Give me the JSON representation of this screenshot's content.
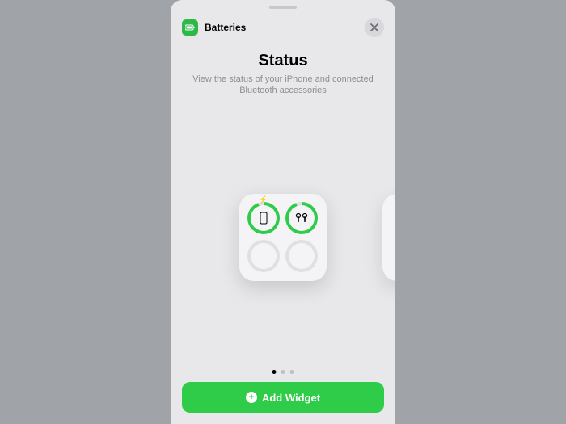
{
  "header": {
    "app_name": "Batteries"
  },
  "content": {
    "title": "Status",
    "subtitle": "View the status of your iPhone and connected Bluetooth accessories"
  },
  "widget": {
    "slots": [
      {
        "device": "iphone",
        "charging": true,
        "active": true
      },
      {
        "device": "airpods",
        "charging": false,
        "active": true
      },
      {
        "device": "none",
        "active": false
      },
      {
        "device": "none",
        "active": false
      }
    ]
  },
  "pagination": {
    "current": 0,
    "total": 3
  },
  "actions": {
    "add_widget_label": "Add Widget"
  },
  "colors": {
    "accent": "#2fcc4a",
    "close_bg": "#d8d8dc"
  }
}
